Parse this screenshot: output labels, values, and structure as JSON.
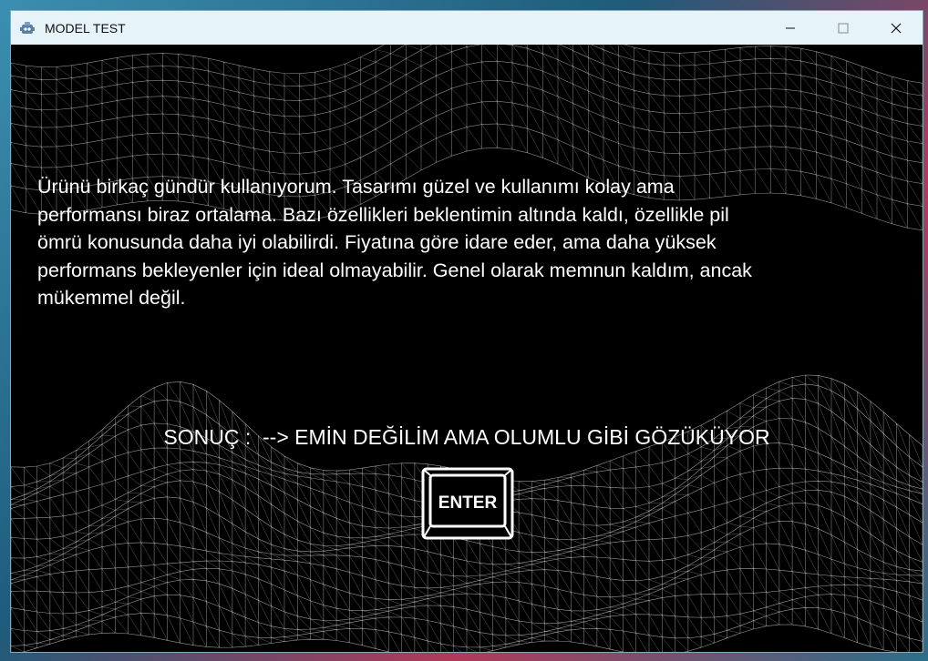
{
  "window": {
    "title": "MODEL TEST",
    "icons": {
      "app": "robot-app-icon",
      "minimize": "minimize-icon",
      "maximize": "maximize-icon",
      "close": "close-icon"
    }
  },
  "main": {
    "review_text": "Ürünü birkaç gündür kullanıyorum. Tasarımı güzel ve kullanımı kolay ama\nperformansı biraz ortalama. Bazı özellikleri beklentimin altında kaldı, özellikle pil\nömrü konusunda daha iyi olabilirdi. Fiyatına göre idare eder, ama daha yüksek\nperformans bekleyenler için ideal olmayabilir. Genel olarak memnun kaldım, ancak\nmükemmel değil.",
    "result_text": "SONUÇ :  --> EMİN DEĞİLİM AMA OLUMLU GİBİ GÖZÜKÜYOR",
    "enter_button": {
      "label": "ENTER",
      "icon": "enter-key-icon"
    }
  },
  "colors": {
    "background": "#000000",
    "text": "#ffffff",
    "titlebar": "#e6f3f8"
  }
}
